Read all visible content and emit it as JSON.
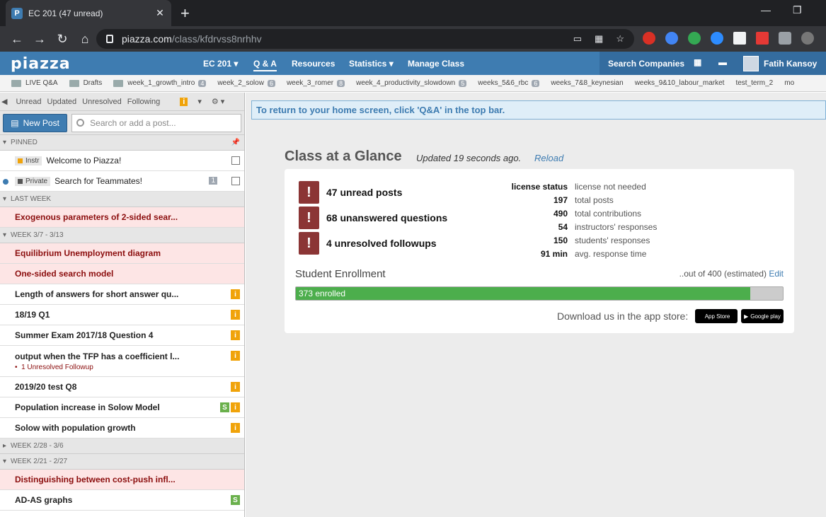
{
  "browser": {
    "tab_title": "EC 201 (47 unread)",
    "favicon": "P",
    "url_host": "piazza.com",
    "url_path": "/class/kfdrvss8nrhhv"
  },
  "topbar": {
    "logo": "piazza",
    "course": "EC 201 ▾",
    "qa": "Q & A",
    "resources": "Resources",
    "statistics": "Statistics ▾",
    "manage": "Manage Class",
    "search_companies": "Search Companies",
    "user": "Fatih Kansoy"
  },
  "folders": [
    {
      "label": "LIVE Q&A",
      "count": ""
    },
    {
      "label": "Drafts",
      "count": ""
    },
    {
      "label": "week_1_growth_intro",
      "count": "4"
    },
    {
      "label": "week_2_solow",
      "count": "6"
    },
    {
      "label": "week_3_romer",
      "count": "8"
    },
    {
      "label": "week_4_productivity_slowdown",
      "count": "5"
    },
    {
      "label": "weeks_5&6_rbc",
      "count": "6"
    },
    {
      "label": "weeks_7&8_keynesian",
      "count": ""
    },
    {
      "label": "weeks_9&10_labour_market",
      "count": ""
    },
    {
      "label": "test_term_2",
      "count": ""
    },
    {
      "label": "mo",
      "count": ""
    }
  ],
  "filters": [
    "Unread",
    "Updated",
    "Unresolved",
    "Following"
  ],
  "new_post": "New Post",
  "search_placeholder": "Search or add a post...",
  "groups": {
    "pinned": "PINNED",
    "last_week": "LAST WEEK",
    "week_3_7": "WEEK 3/7 - 3/13",
    "week_2_28": "WEEK 2/28 - 3/6",
    "week_2_21": "WEEK 2/21 - 2/27"
  },
  "pinned": [
    {
      "tag": "Instr",
      "title": "Welcome to Piazza!"
    },
    {
      "tag": "Private",
      "title": "Search for Teammates!",
      "count": "1"
    }
  ],
  "last_week": [
    {
      "title": "Exogenous parameters of 2-sided sear..."
    }
  ],
  "week3": [
    {
      "title": "Equilibrium Unemployment diagram"
    },
    {
      "title": "One-sided search model"
    },
    {
      "title": "Length of answers for short answer qu..."
    },
    {
      "title": "18/19 Q1"
    },
    {
      "title": "Summer Exam 2017/18 Question 4"
    },
    {
      "title": "output when the TFP has a coefficient l...",
      "sub": "1 Unresolved Followup"
    },
    {
      "title": "2019/20 test Q8"
    },
    {
      "title": "Population increase in Solow Model"
    },
    {
      "title": "Solow with population growth"
    }
  ],
  "week2": [
    {
      "title": "Distinguishing between cost-push infl..."
    },
    {
      "title": "AD-AS graphs"
    }
  ],
  "main": {
    "notice": "To return to your home screen, click 'Q&A' in the top bar.",
    "title": "Class at a Glance",
    "updated": "Updated 19 seconds ago.",
    "reload": "Reload",
    "stats": [
      "47 unread posts",
      "68 unanswered questions",
      "4 unresolved followups"
    ],
    "kv": [
      {
        "k": "license status",
        "v": "license not needed"
      },
      {
        "k": "197",
        "v": "total posts"
      },
      {
        "k": "490",
        "v": "total contributions"
      },
      {
        "k": "54",
        "v": "instructors' responses"
      },
      {
        "k": "150",
        "v": "students' responses"
      },
      {
        "k": "91 min",
        "v": "avg. response time"
      }
    ],
    "enrollment_label": "Student Enrollment",
    "out_of": "..out of 400 (estimated)",
    "edit": "Edit",
    "enrolled_text": "373 enrolled",
    "enrolled": 373,
    "capacity": 400,
    "app_store_label": "Download us in the app store:",
    "app_store": "App Store",
    "google_play": "Google play"
  }
}
